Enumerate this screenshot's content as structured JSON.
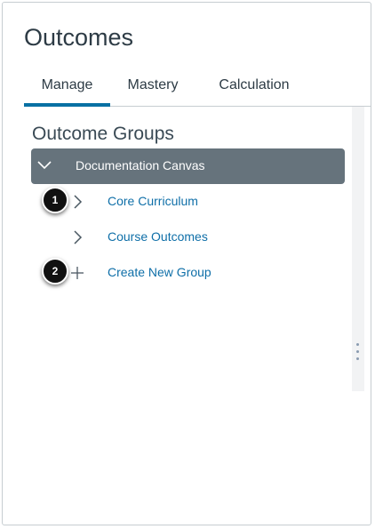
{
  "page": {
    "title": "Outcomes"
  },
  "tabs": [
    {
      "label": "Manage",
      "active": true
    },
    {
      "label": "Mastery",
      "active": false
    },
    {
      "label": "Calculation",
      "active": false
    }
  ],
  "groups_panel": {
    "title": "Outcome Groups",
    "root_group": {
      "label": "Documentation Canvas",
      "icon": "chevron-down-icon"
    },
    "items": [
      {
        "label": "Core Curriculum",
        "icon": "chevron-right-icon",
        "callout": "1"
      },
      {
        "label": "Course Outcomes",
        "icon": "chevron-right-icon"
      },
      {
        "label": "Create New Group",
        "icon": "plus-icon",
        "callout": "2"
      }
    ]
  },
  "colors": {
    "accent": "#0770a3",
    "link": "#0f6fa8",
    "group_header_bg": "#66737c",
    "text": "#2d3b45"
  }
}
